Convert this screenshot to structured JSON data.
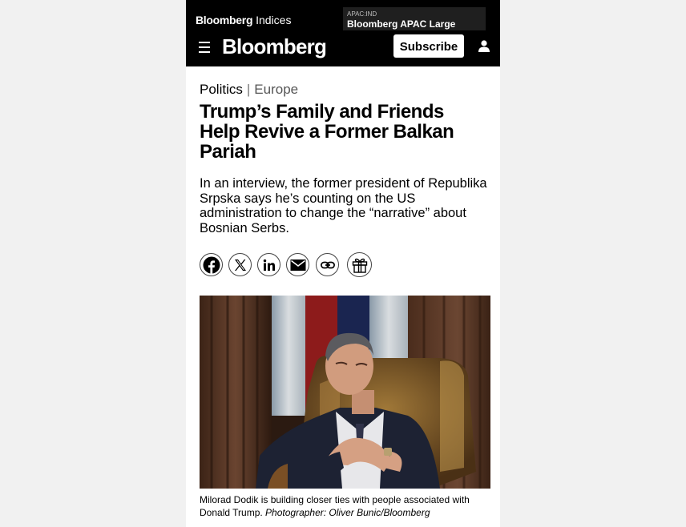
{
  "ticker": {
    "brand_bold": "Bloomberg",
    "brand_light": "Indices",
    "card_code": "APAC:IND",
    "card_name": "Bloomberg APAC Large"
  },
  "header": {
    "logo": "Bloomberg",
    "subscribe_label": "Subscribe",
    "icons": [
      "menu-icon",
      "user-icon"
    ]
  },
  "article": {
    "category": "Politics",
    "separator": "|",
    "subcategory": "Europe",
    "headline": "Trump’s Family and Friends Help Revive a Former Balkan Pariah",
    "dek": "In an interview, the former president of Republika Srpska says he’s counting on the US administration to change the “narrative” about Bosnian Serbs.",
    "share_icons": [
      "facebook-icon",
      "x-icon",
      "linkedin-icon",
      "email-icon",
      "link-icon",
      "gift-icon"
    ],
    "caption_text": "Milorad Dodik is building closer ties with people associated with Donald Trump.",
    "caption_credit": "Photographer: Oliver Bunic/Bloomberg"
  },
  "colors": {
    "header_bg": "#000000",
    "page_bg": "#f1f1f1",
    "content_bg": "#ffffff"
  }
}
